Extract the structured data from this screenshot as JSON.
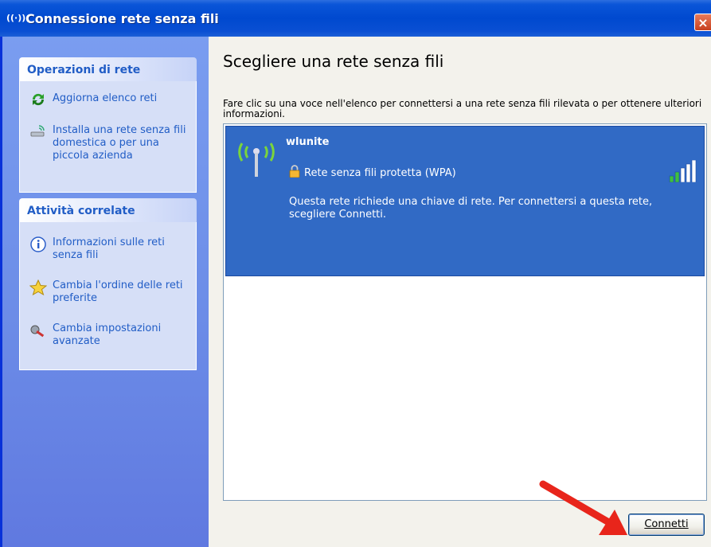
{
  "window": {
    "title": "Connessione rete senza fili",
    "close_label": "×"
  },
  "sidebar": {
    "network_tasks": {
      "header": "Operazioni di rete",
      "items": [
        {
          "label": "Aggiorna elenco reti",
          "icon": "refresh-icon"
        },
        {
          "label": "Installa una rete senza fili domestica o per una piccola azienda",
          "icon": "wireless-setup-icon"
        }
      ]
    },
    "related_tasks": {
      "header": "Attività correlate",
      "items": [
        {
          "label": "Informazioni sulle reti senza fili",
          "icon": "info-icon"
        },
        {
          "label": "Cambia l'ordine delle reti preferite",
          "icon": "star-icon"
        },
        {
          "label": "Cambia impostazioni avanzate",
          "icon": "settings-tools-icon"
        }
      ]
    }
  },
  "main": {
    "heading": "Scegliere una rete senza fili",
    "instructions": "Fare clic su una voce nell'elenco per connettersi a una rete senza fili rilevata o per ottenere ulteriori informazioni.",
    "networks": [
      {
        "name": "wlunite",
        "security": "Rete senza fili protetta (WPA)",
        "description": "Questa rete richiede una chiave di rete. Per connettersi a questa rete, scegliere Connetti.",
        "signal_bars": 5,
        "signal_max": 5,
        "selected": true
      }
    ],
    "connect_button": "Connetti"
  },
  "colors": {
    "titlebar": "#0049cf",
    "sidebar": "#6d8ee8",
    "selected_item": "#316ac5",
    "annotation_arrow": "#e8251b"
  }
}
